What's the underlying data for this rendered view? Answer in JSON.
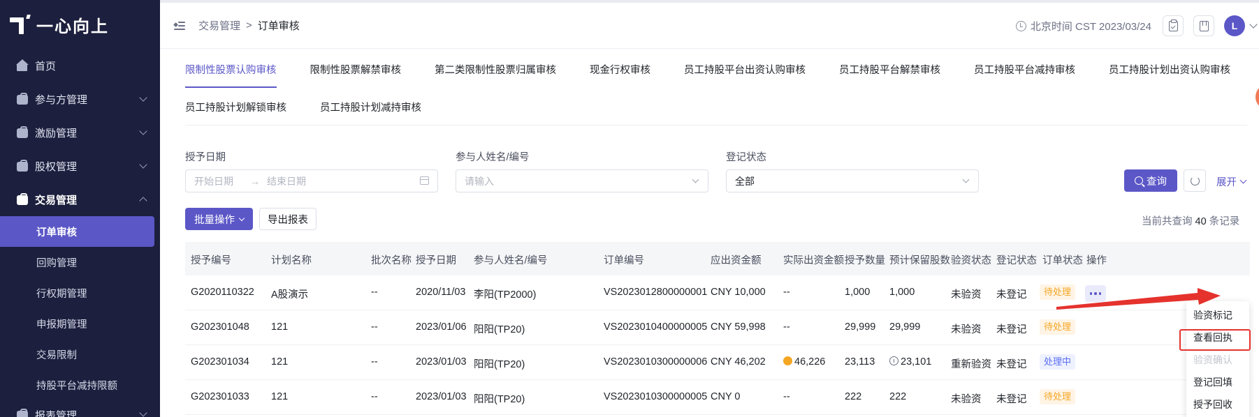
{
  "brand": {
    "name": "一心向上"
  },
  "sidebar": {
    "items": [
      {
        "label": "首页",
        "icon": "house-icon"
      },
      {
        "label": "参与方管理",
        "icon": "box-icon"
      },
      {
        "label": "激励管理",
        "icon": "box-icon"
      },
      {
        "label": "股权管理",
        "icon": "box-icon"
      },
      {
        "label": "交易管理",
        "icon": "box-icon"
      }
    ],
    "sub_items": [
      {
        "label": "订单审核",
        "active": true
      },
      {
        "label": "回购管理"
      },
      {
        "label": "行权期管理"
      },
      {
        "label": "申报期管理"
      },
      {
        "label": "交易限制"
      },
      {
        "label": "持股平台减持限额"
      }
    ],
    "bottom_item": {
      "label": "报表管理",
      "icon": "box-icon"
    }
  },
  "topbar": {
    "breadcrumb": [
      "交易管理",
      "订单审核"
    ],
    "separator": ">",
    "time": "北京时间 CST 2023/03/24",
    "avatar": "L"
  },
  "tabs": {
    "row1": [
      "限制性股票认购审核",
      "限制性股票解禁审核",
      "第二类限制性股票归属审核",
      "现金行权审核",
      "员工持股平台出资认购审核",
      "员工持股平台解禁审核",
      "员工持股平台减持审核",
      "员工持股计划出资认购审核"
    ],
    "row2": [
      "员工持股计划解锁审核",
      "员工持股计划减持审核"
    ]
  },
  "filters": {
    "grant_date": {
      "label": "授予日期",
      "start_placeholder": "开始日期",
      "end_placeholder": "结束日期",
      "arrow": "→"
    },
    "participant": {
      "label": "参与人姓名/编号",
      "placeholder": "请输入"
    },
    "reg_status": {
      "label": "登记状态",
      "value": "全部"
    },
    "query_label": "查询",
    "expand_label": "展开"
  },
  "actions": {
    "batch_label": "批量操作",
    "export_label": "导出报表",
    "count_prefix": "当前共查询",
    "count": "40",
    "count_suffix": "条记录"
  },
  "table": {
    "headers": [
      "授予编号",
      "计划名称",
      "批次名称",
      "授予日期",
      "参与人姓名/编号",
      "订单编号",
      "应出资金额",
      "实际出资金额",
      "授予数量",
      "预计保留股数",
      "验资状态",
      "登记状态",
      "订单状态",
      "操作"
    ],
    "rows": [
      {
        "grant_no": "G2020110322",
        "plan": "A股演示",
        "batch": "--",
        "date": "2020/11/03",
        "participant": "李阳(TP2000)",
        "order_no": "VS2023012800000001",
        "due": "CNY 10,000",
        "actual": "--",
        "qty": "1,000",
        "reserve": "1,000",
        "verify": "未验资",
        "reg": "未登记",
        "order_status": "待处理",
        "status_color": "orange"
      },
      {
        "grant_no": "G202301048",
        "plan": "121",
        "batch": "--",
        "date": "2023/01/06",
        "participant": "阳阳(TP20)",
        "order_no": "VS2023010400000005",
        "due": "CNY 59,998",
        "actual": "--",
        "qty": "29,999",
        "reserve": "29,999",
        "verify": "未验资",
        "reg": "未登记",
        "order_status": "待处理",
        "status_color": "orange"
      },
      {
        "grant_no": "G202301034",
        "plan": "121",
        "batch": "--",
        "date": "2023/01/03",
        "participant": "阳阳(TP20)",
        "order_no": "VS2023010300000006",
        "due": "CNY 46,202",
        "actual": "46,226",
        "qty": "23,113",
        "reserve": "23,101",
        "verify": "重新验资",
        "reg": "未登记",
        "order_status": "处理中",
        "status_color": "blue"
      },
      {
        "grant_no": "G202301033",
        "plan": "121",
        "batch": "--",
        "date": "2023/01/03",
        "participant": "阳阳(TP20)",
        "order_no": "VS2023010300000005",
        "due": "CNY 0",
        "actual": "--",
        "qty": "222",
        "reserve": "222",
        "verify": "未验资",
        "reg": "未登记",
        "order_status": "待处理",
        "status_color": "orange"
      }
    ]
  },
  "dropdown": {
    "items": [
      {
        "label": "验资标记",
        "disabled": false
      },
      {
        "label": "查看回执",
        "disabled": false
      },
      {
        "label": "验资确认",
        "disabled": true
      },
      {
        "label": "登记回填",
        "disabled": false
      },
      {
        "label": "授予回收",
        "disabled": false
      }
    ]
  },
  "colors": {
    "accent": "#5b57c7",
    "sidebar_bg": "#1c1f3d",
    "annotation_red": "#e5322d"
  }
}
